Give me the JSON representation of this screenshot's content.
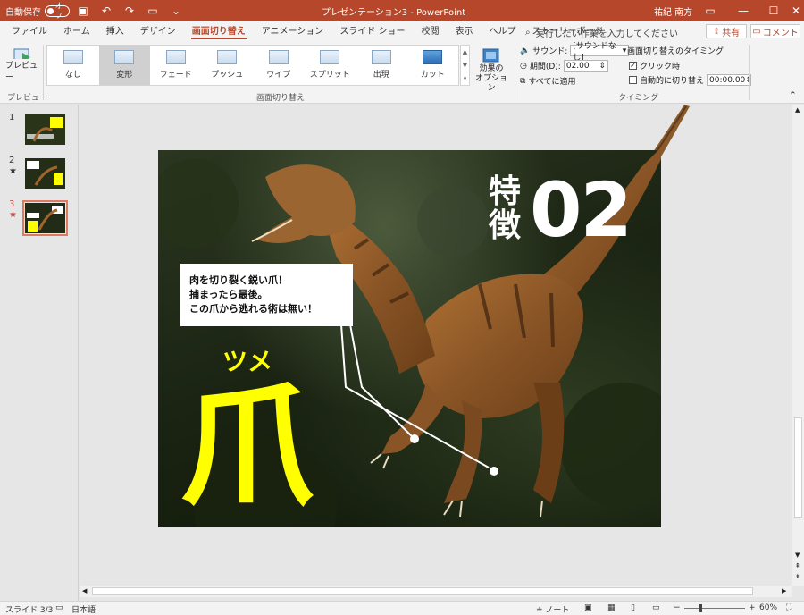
{
  "titlebar": {
    "autosave_label": "自動保存",
    "autosave_state": "オフ",
    "doc_title": "プレゼンテーション3 - PowerPoint",
    "user": "祐紀 南方"
  },
  "tabs": [
    "ファイル",
    "ホーム",
    "挿入",
    "デザイン",
    "画面切り替え",
    "アニメーション",
    "スライド ショー",
    "校閲",
    "表示",
    "ヘルプ",
    "ストーリーボード"
  ],
  "active_tab": "画面切り替え",
  "tell_me": "実行したい作業を入力してください",
  "share_label": "共有",
  "comment_label": "コメント",
  "ribbon": {
    "preview_label": "プレビュー",
    "preview_group": "プレビュー",
    "transitions_group": "画面切り替え",
    "transitions": [
      "なし",
      "変形",
      "フェード",
      "プッシュ",
      "ワイプ",
      "スプリット",
      "出現",
      "カット"
    ],
    "selected_transition": "変形",
    "effect_options": [
      "効果の",
      "オプション"
    ],
    "timing_group": "タイミング",
    "sound_label": "サウンド:",
    "sound_value": "[サウンドなし]",
    "duration_label": "期間(D):",
    "duration_value": "02.00",
    "apply_all_label": "すべてに適用",
    "advance_header": "画面切り替えのタイミング",
    "on_click_label": "クリック時",
    "on_click_checked": true,
    "auto_after_label": "自動的に切り替え",
    "auto_after_value": "00:00.00",
    "auto_after_checked": false
  },
  "slides": [
    {
      "number": "1",
      "star": ""
    },
    {
      "number": "2",
      "star": "★"
    },
    {
      "number": "3",
      "star": "★"
    }
  ],
  "active_slide": "3",
  "slide": {
    "feature_char_1": "特",
    "feature_char_2": "徴",
    "feature_num": "02",
    "callout_lines": [
      "肉を切り裂く鋭い爪！",
      "捕まったら最後。",
      "この爪から逃れる術は無い！"
    ],
    "reading": "ツメ",
    "big_char": "爪"
  },
  "statusbar": {
    "slide_info": "スライド 3/3",
    "language": "日本語",
    "notes_label": "ノート",
    "zoom": "60%"
  },
  "colors": {
    "accent": "#b7472a",
    "highlight_yellow": "#ffff00"
  }
}
